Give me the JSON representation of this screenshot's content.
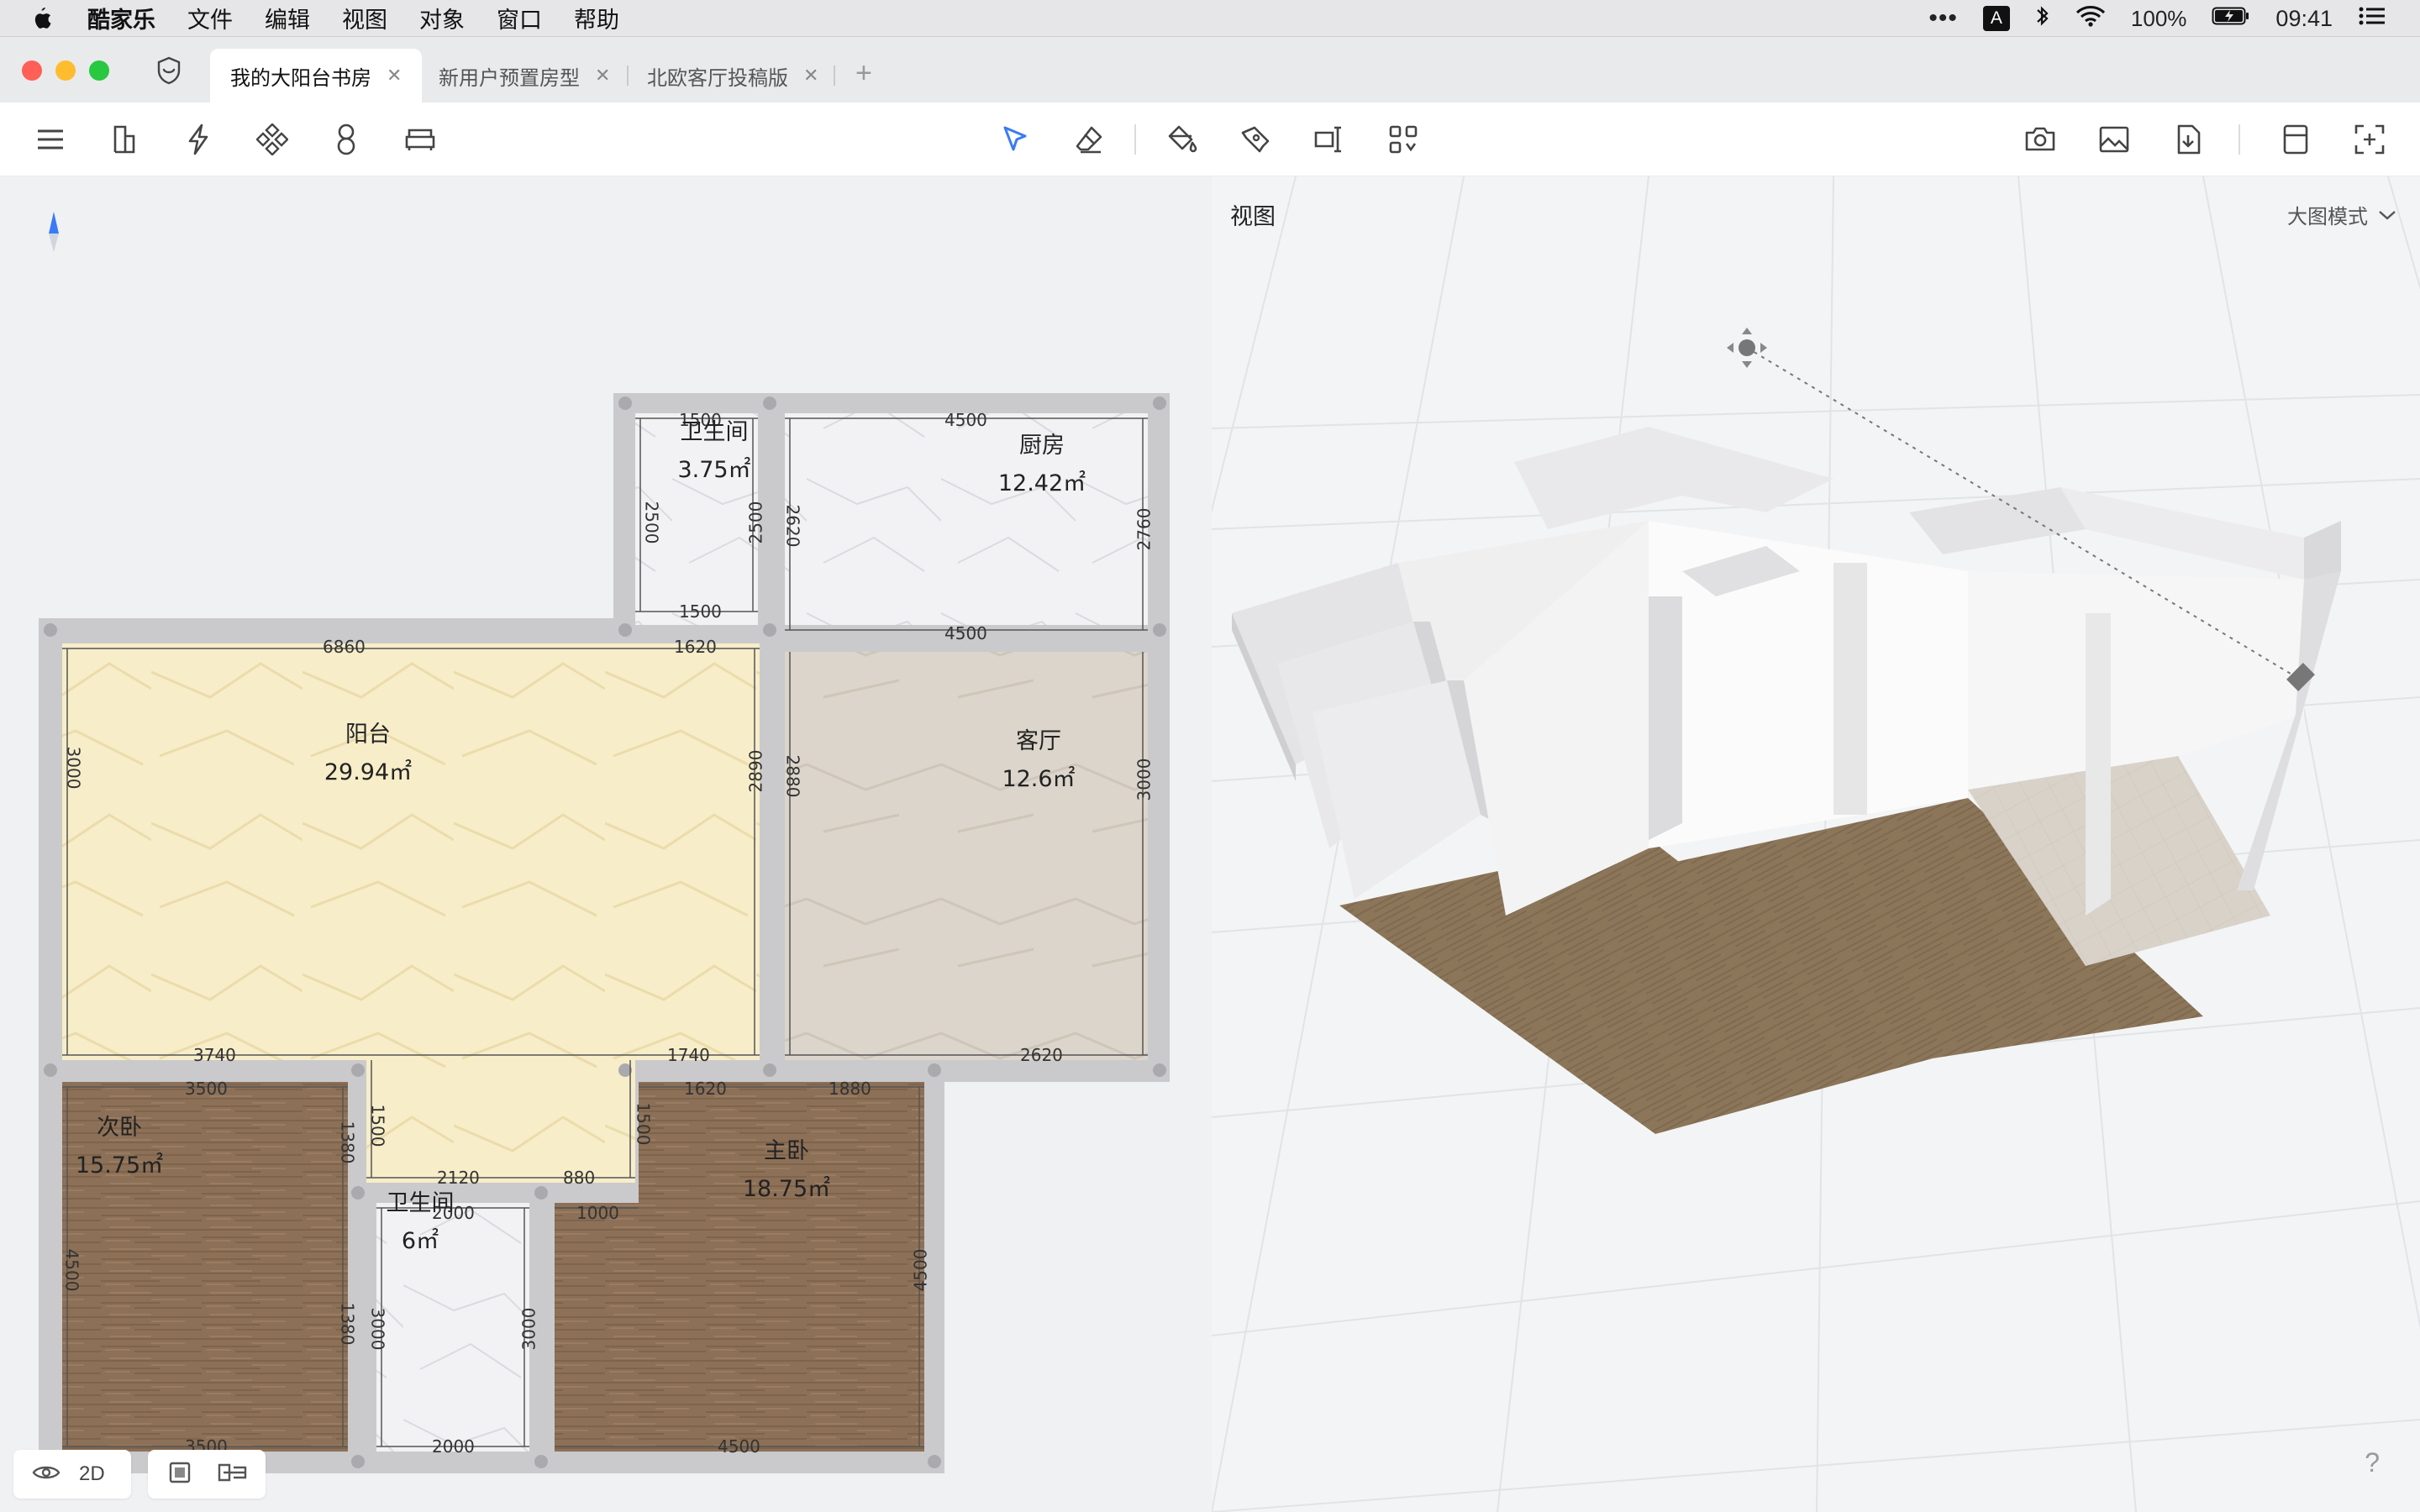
{
  "menubar": {
    "app_name": "酷家乐",
    "items": [
      "文件",
      "编辑",
      "视图",
      "对象",
      "窗口",
      "帮助"
    ],
    "ime_label": "A",
    "battery": "100%",
    "time": "09:41"
  },
  "tabs": [
    {
      "label": "我的大阳台书房",
      "active": true
    },
    {
      "label": "新用户预置房型",
      "active": false
    },
    {
      "label": "北欧客厅投稿版",
      "active": false
    }
  ],
  "toolbar": {
    "left_icons": [
      "menu-icon",
      "door-icon",
      "lightning-icon",
      "components-icon",
      "figure-eight-icon",
      "sofa-icon"
    ],
    "center_icons": [
      "select-pointer-icon",
      "eraser-icon",
      "paint-bucket-icon",
      "tag-icon",
      "ruler-text-icon",
      "grid-apps-icon"
    ],
    "right_icons": [
      "camera-icon",
      "image-icon",
      "download-icon",
      "layout-icon",
      "fit-screen-icon"
    ]
  },
  "floorplan": {
    "rooms": [
      {
        "name": "卫生间",
        "area": "3.75㎡"
      },
      {
        "name": "厨房",
        "area": "12.42㎡"
      },
      {
        "name": "阳台",
        "area": "29.94㎡"
      },
      {
        "name": "客厅",
        "area": "12.6㎡"
      },
      {
        "name": "次卧",
        "area": "15.75㎡"
      },
      {
        "name": "卫生间",
        "area": "6㎡"
      },
      {
        "name": "主卧",
        "area": "18.75㎡"
      }
    ],
    "dimensions": {
      "bath1_top": "1500",
      "bath1_bottom": "1500",
      "bath1_left": "2500",
      "bath1_right": "2500",
      "kitchen_top": "4500",
      "kitchen_bottom": "4500",
      "kitchen_left": "2620",
      "kitchen_right": "2760",
      "balcony_top": "6860",
      "balcony_top2": "1620",
      "balcony_left": "3000",
      "balcony_right": "2890",
      "balcony_b1": "3740",
      "balcony_b2": "1740",
      "balcony_inner_left": "1500",
      "balcony_inner_right": "1500",
      "balcony_b3": "2120",
      "balcony_b4": "880",
      "living_left": "2880",
      "living_right": "3000",
      "living_bottom": "2620",
      "bed2_top": "3500",
      "bed2_bottom": "3500",
      "bed2_left": "4500",
      "bed2_right1": "1380",
      "bed2_right2": "1380",
      "bath2_top": "2000",
      "bath2_bottom": "2000",
      "bath2_left": "3000",
      "bath2_right": "3000",
      "master_top1": "1620",
      "master_top2": "1880",
      "master_top3": "1000",
      "master_right": "4500",
      "master_bottom": "4500"
    }
  },
  "view_panel": {
    "title": "视图",
    "mode": "大图模式"
  },
  "bottom_bar": {
    "view_mode": "2D"
  },
  "help_label": "?",
  "colors": {
    "wall": "#c9c9cb",
    "balcony_floor": "#f6ecc8",
    "wood_floor": "#8c7057",
    "marble_floor": "#f3f3f5",
    "living_floor": "#dcd6cc",
    "accent": "#3a7bf5"
  }
}
